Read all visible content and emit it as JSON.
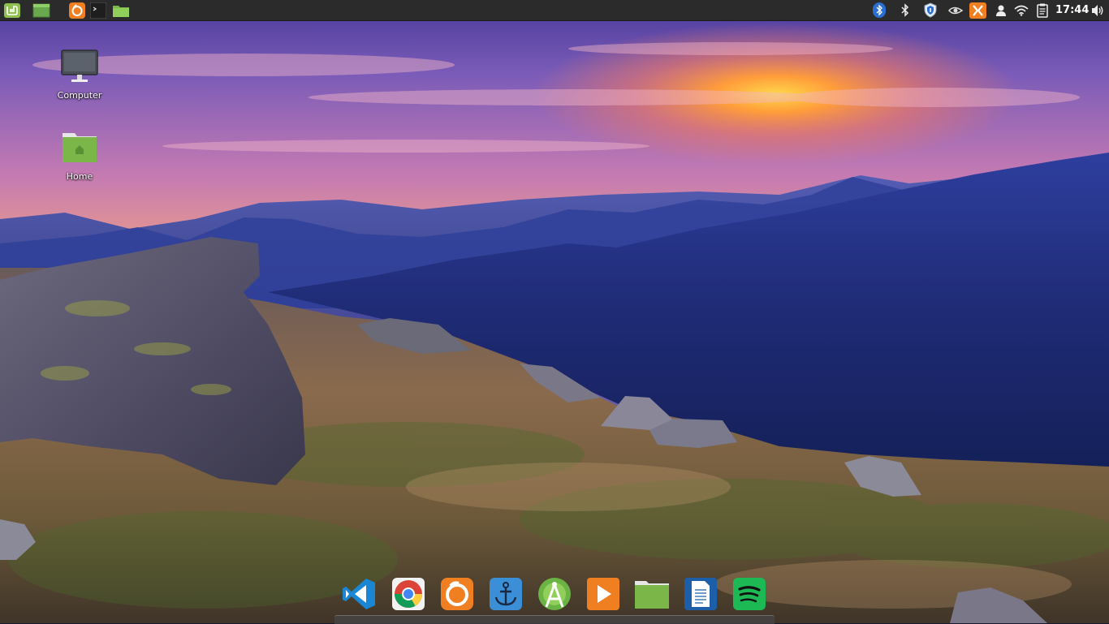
{
  "top_panel": {
    "launchers": [
      {
        "name": "mint-menu-icon"
      },
      {
        "name": "show-desktop-icon"
      },
      {
        "name": "firefox-launcher-icon"
      },
      {
        "name": "terminal-launcher-icon"
      },
      {
        "name": "files-launcher-icon"
      }
    ],
    "tray": [
      {
        "name": "bluetooth-icon"
      },
      {
        "name": "bluetooth-icon"
      },
      {
        "name": "shield-update-icon"
      },
      {
        "name": "nvidia-icon"
      },
      {
        "name": "xampp-icon"
      },
      {
        "name": "user-icon"
      },
      {
        "name": "wifi-icon"
      },
      {
        "name": "clipboard-icon"
      }
    ],
    "clock": "17:44",
    "volume": {
      "name": "volume-icon"
    }
  },
  "desktop": {
    "icons": [
      {
        "label": "Computer",
        "icon": "computer-icon"
      },
      {
        "label": "Home",
        "icon": "home-folder-icon"
      }
    ]
  },
  "dock": {
    "items": [
      {
        "icon": "vscode-icon"
      },
      {
        "icon": "chrome-icon"
      },
      {
        "icon": "firefox-icon"
      },
      {
        "icon": "anchor-icon"
      },
      {
        "icon": "android-studio-icon"
      },
      {
        "icon": "media-player-icon"
      },
      {
        "icon": "folder-icon"
      },
      {
        "icon": "text-editor-icon"
      },
      {
        "icon": "spotify-icon"
      }
    ]
  },
  "colors": {
    "panel_bg": "#2b2b2b",
    "mint_green": "#8fbf4f",
    "xampp_orange": "#f07f22"
  }
}
